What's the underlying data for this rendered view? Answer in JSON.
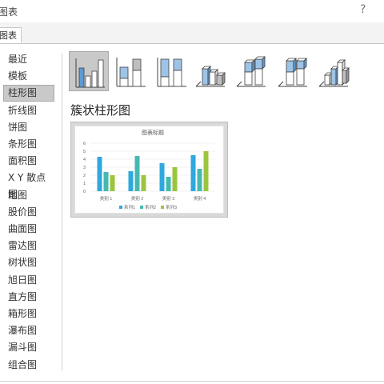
{
  "window": {
    "title": "图表",
    "help_icon": "?"
  },
  "tabs": [
    {
      "label": "图表"
    }
  ],
  "sidebar": {
    "items": [
      {
        "label": "最近"
      },
      {
        "label": "模板"
      },
      {
        "label": "柱形图",
        "selected": true
      },
      {
        "label": "折线图"
      },
      {
        "label": "饼图"
      },
      {
        "label": "条形图"
      },
      {
        "label": "面积图"
      },
      {
        "label": "X Y 散点图"
      },
      {
        "label": "地图"
      },
      {
        "label": "股价图"
      },
      {
        "label": "曲面图"
      },
      {
        "label": "雷达图"
      },
      {
        "label": "树状图"
      },
      {
        "label": "旭日图"
      },
      {
        "label": "直方图"
      },
      {
        "label": "箱形图"
      },
      {
        "label": "瀑布图"
      },
      {
        "label": "漏斗图"
      },
      {
        "label": "组合图"
      }
    ]
  },
  "subtypes": [
    {
      "icon": "clustered-column-icon",
      "selected": true
    },
    {
      "icon": "stacked-column-icon"
    },
    {
      "icon": "percent-stacked-column-icon"
    },
    {
      "icon": "3d-clustered-column-icon"
    },
    {
      "icon": "3d-stacked-column-icon"
    },
    {
      "icon": "3d-percent-stacked-column-icon"
    },
    {
      "icon": "3d-column-icon"
    }
  ],
  "section_title": "簇状柱形图",
  "colors": {
    "series1": "#2EA8DF",
    "series2": "#45B9B0",
    "series3": "#9BC53D",
    "selected_bg": "#C9C9C9"
  },
  "chart_data": {
    "type": "bar",
    "title": "图表标题",
    "categories": [
      "类别 1",
      "类别 2",
      "类别 3",
      "类别 4"
    ],
    "series": [
      {
        "name": "系列1",
        "values": [
          4.3,
          2.5,
          3.5,
          4.5
        ]
      },
      {
        "name": "系列2",
        "values": [
          2.4,
          4.4,
          1.8,
          2.8
        ]
      },
      {
        "name": "系列3",
        "values": [
          2,
          2,
          3,
          5
        ]
      }
    ],
    "ylim": [
      0,
      6
    ],
    "yticks": [
      0,
      1,
      2,
      3,
      4,
      5,
      6
    ],
    "grid": true,
    "legend": "bottom"
  }
}
